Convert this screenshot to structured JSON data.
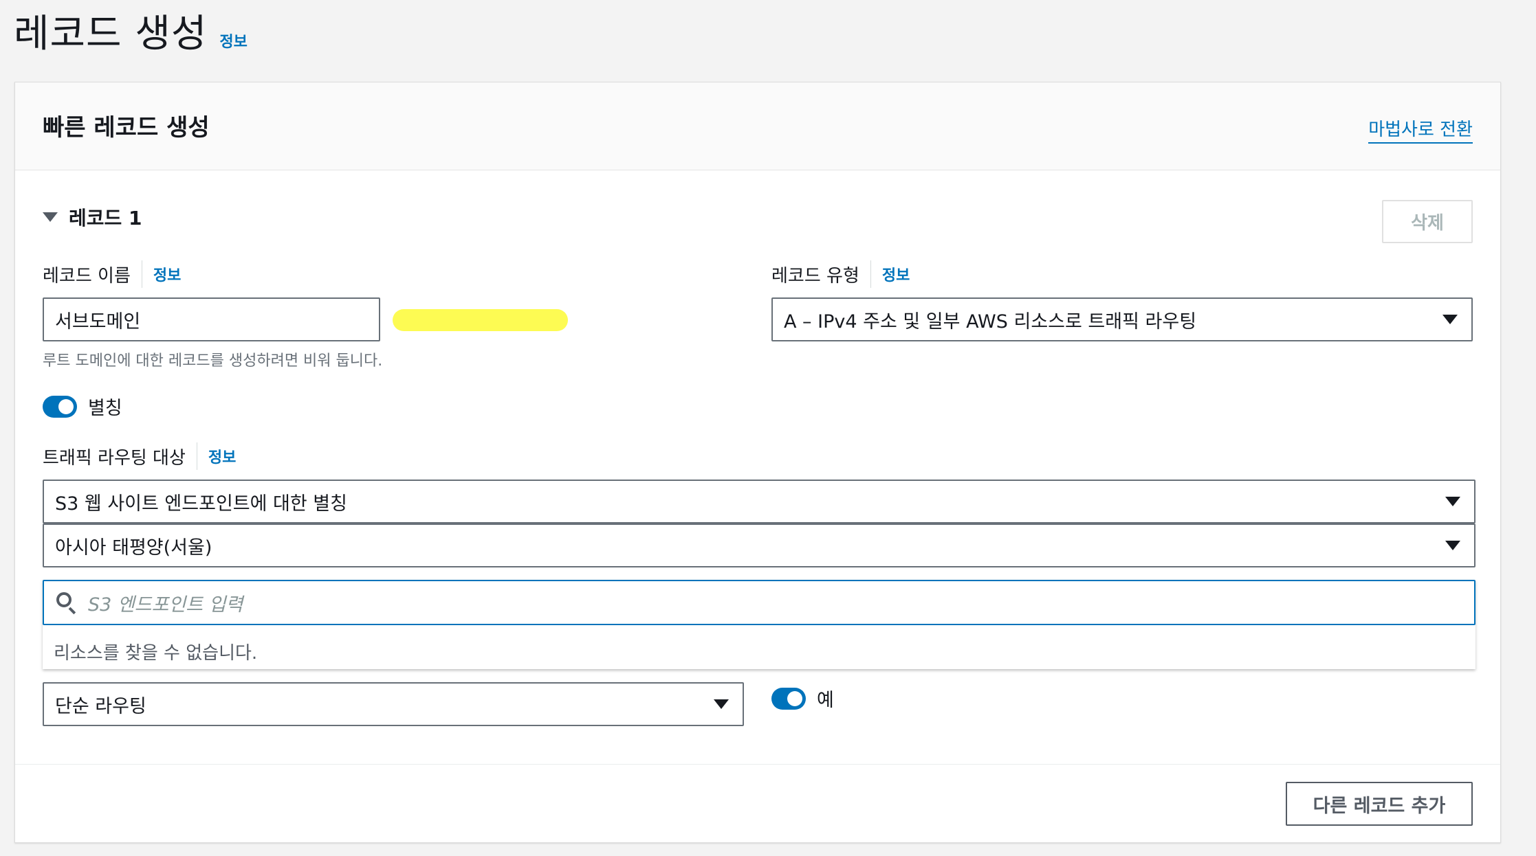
{
  "page": {
    "title": "레코드 생성",
    "info": "정보"
  },
  "panel": {
    "title": "빠른 레코드 생성",
    "wizard_link": "마법사로 전환"
  },
  "record": {
    "header": "레코드 1",
    "delete_label": "삭제",
    "name": {
      "label": "레코드 이름",
      "info": "정보",
      "value": "서브도메인",
      "hint": "루트 도메인에 대한 레코드를 생성하려면 비워 둡니다."
    },
    "type": {
      "label": "레코드 유형",
      "info": "정보",
      "value": "A – IPv4 주소 및 일부 AWS 리소스로 트래픽 라우팅"
    },
    "alias": {
      "label": "별칭",
      "enabled": true
    },
    "routing_target": {
      "label": "트래픽 라우팅 대상",
      "info": "정보",
      "endpoint_type": "S3 웹 사이트 엔드포인트에 대한 별칭",
      "region": "아시아 태평양(서울)",
      "search_placeholder": "S3 엔드포인트 입력",
      "no_results": "리소스를 찾을 수 없습니다."
    },
    "routing_policy": {
      "value": "단순 라우팅"
    },
    "evaluate_health": {
      "label": "예",
      "enabled": true
    }
  },
  "footer": {
    "add_record_label": "다른 레코드 추가"
  },
  "colors": {
    "accent": "#0073bb",
    "highlight": "#fdfb4a"
  }
}
